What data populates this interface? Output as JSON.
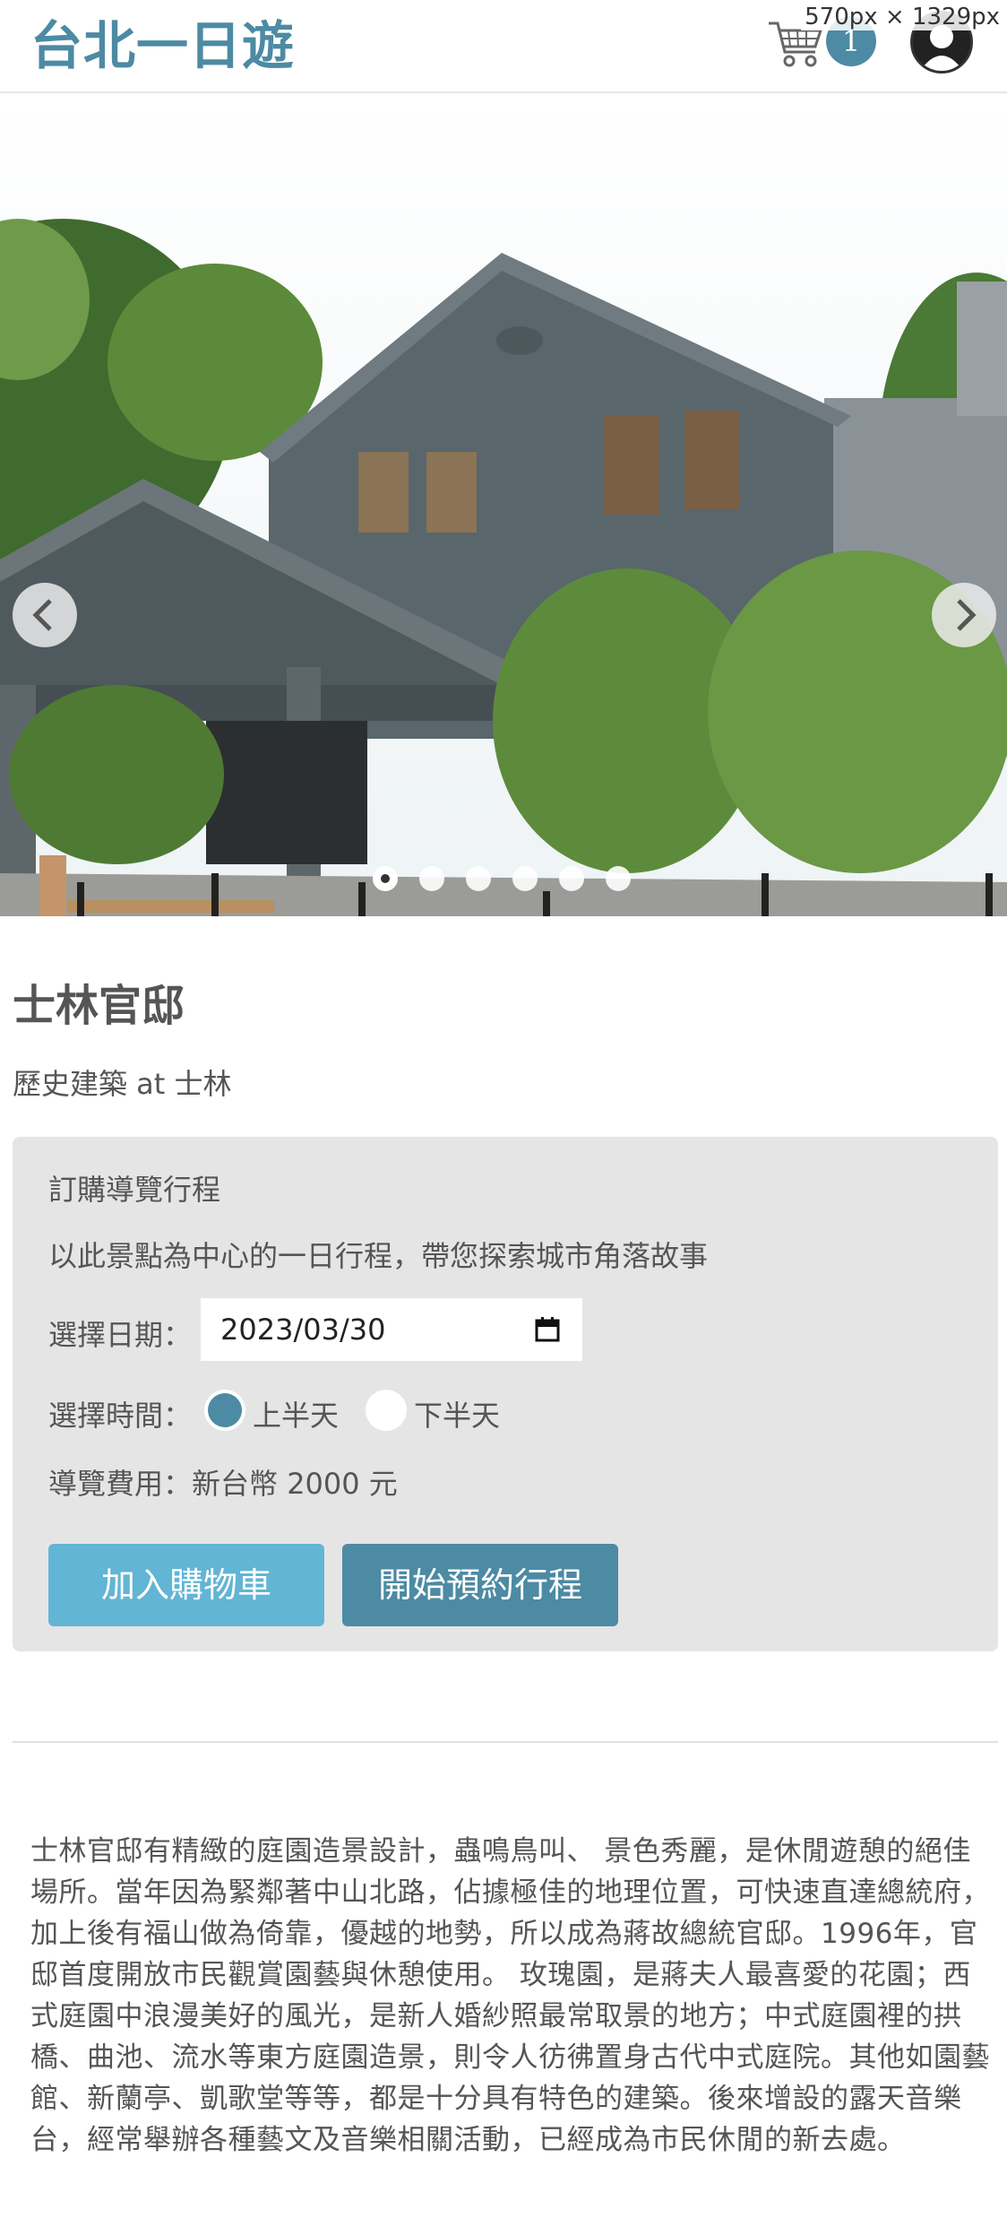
{
  "dev_overlay": "570px × 1329px",
  "header": {
    "brand": "台北一日遊",
    "cart_count": "1"
  },
  "carousel": {
    "slide_count": 6,
    "active_index": 0,
    "image_alt": "士林官邸"
  },
  "attraction": {
    "name": "士林官邸",
    "category_line": "歷史建築 at 士林"
  },
  "booking": {
    "heading": "訂購導覽行程",
    "description": "以此景點為中心的一日行程，帶您探索城市角落故事",
    "date_label": "選擇日期：",
    "date_value": "2023/03/30",
    "time_label": "選擇時間：",
    "time_options": [
      "上半天",
      "下半天"
    ],
    "time_selected": "上半天",
    "fee_label": "導覽費用：",
    "fee_value": "新台幣 2000 元",
    "add_to_cart_label": "加入購物車",
    "book_label": "開始預約行程"
  },
  "description": "士林官邸有精緻的庭園造景設計，蟲鳴鳥叫、 景色秀麗，是休閒遊憩的絕佳場所。當年因為緊鄰著中山北路，佔據極佳的地理位置，可快速直達總統府，加上後有福山做為倚靠，優越的地勢，所以成為蔣故總統官邸。1996年，官邸首度開放市民觀賞園藝與休憩使用。 玫瑰園，是蔣夫人最喜愛的花園；西式庭園中浪漫美好的風光，是新人婚紗照最常取景的地方；中式庭園裡的拱橋、曲池、流水等東方庭園造景，則令人彷彿置身古代中式庭院。其他如園藝館、新蘭亭、凱歌堂等等，都是十分具有特色的建築。後來增設的露天音樂台，經常舉辦各種藝文及音樂相關活動，已經成為市民休閒的新去處。",
  "colors": {
    "brand": "#4d8aa3",
    "cart_button": "#62b5d4",
    "book_button": "#4d8aa3",
    "card_bg": "#e5e5e6"
  }
}
